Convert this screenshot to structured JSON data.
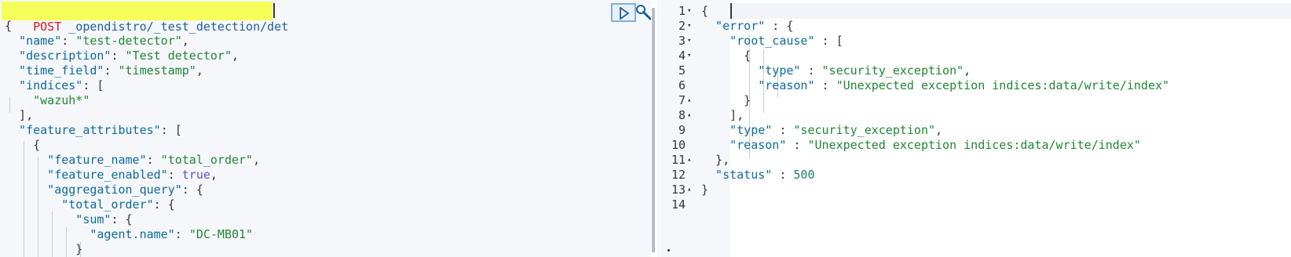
{
  "request": {
    "method": "POST",
    "url": " _opendistro/_test_detection/det",
    "lines": [
      [
        [
          "pun",
          "{"
        ]
      ],
      [
        [
          "key",
          "  \"name\""
        ],
        [
          "pun",
          ": "
        ],
        [
          "str",
          "\"test-detector\""
        ],
        [
          "pun",
          ","
        ]
      ],
      [
        [
          "key",
          "  \"description\""
        ],
        [
          "pun",
          ": "
        ],
        [
          "str",
          "\"Test detector\""
        ],
        [
          "pun",
          ","
        ]
      ],
      [
        [
          "key",
          "  \"time_field\""
        ],
        [
          "pun",
          ": "
        ],
        [
          "str",
          "\"timestamp\""
        ],
        [
          "pun",
          ","
        ]
      ],
      [
        [
          "key",
          "  \"indices\""
        ],
        [
          "pun",
          ": ["
        ]
      ],
      [
        [
          "str",
          "    \"wazuh*\""
        ]
      ],
      [
        [
          "pun",
          "  ],"
        ]
      ],
      [
        [
          "key",
          "  \"feature_attributes\""
        ],
        [
          "pun",
          ": ["
        ]
      ],
      [
        [
          "pun",
          "    {"
        ]
      ],
      [
        [
          "key",
          "      \"feature_name\""
        ],
        [
          "pun",
          ": "
        ],
        [
          "str",
          "\"total_order\""
        ],
        [
          "pun",
          ","
        ]
      ],
      [
        [
          "key",
          "      \"feature_enabled\""
        ],
        [
          "pun",
          ": "
        ],
        [
          "kw",
          "true"
        ],
        [
          "pun",
          ","
        ]
      ],
      [
        [
          "key",
          "      \"aggregation_query\""
        ],
        [
          "pun",
          ": {"
        ]
      ],
      [
        [
          "key",
          "        \"total_order\""
        ],
        [
          "pun",
          ": {"
        ]
      ],
      [
        [
          "key",
          "          \"sum\""
        ],
        [
          "pun",
          ": {"
        ]
      ],
      [
        [
          "key",
          "            \"agent.name\""
        ],
        [
          "pun",
          ": "
        ],
        [
          "str",
          "\"DC-MB01\""
        ]
      ],
      [
        [
          "pun",
          "          }"
        ]
      ]
    ]
  },
  "response": {
    "line_numbers": [
      "1",
      "2",
      "3",
      "4",
      "5",
      "6",
      "7",
      "8",
      "9",
      "10",
      "11",
      "12",
      "13",
      "14"
    ],
    "fold_markers": [
      "▾",
      "▾",
      "▾",
      "▾",
      "",
      "",
      "▴",
      "▴",
      "",
      "",
      "▴",
      "",
      "▴",
      ""
    ],
    "lines": [
      [
        [
          "pun",
          "{"
        ]
      ],
      [
        [
          "key",
          "  \"error\""
        ],
        [
          "pun",
          " : {"
        ]
      ],
      [
        [
          "key",
          "    \"root_cause\""
        ],
        [
          "pun",
          " : ["
        ]
      ],
      [
        [
          "pun",
          "      {"
        ]
      ],
      [
        [
          "key",
          "        \"type\""
        ],
        [
          "pun",
          " : "
        ],
        [
          "str",
          "\"security_exception\""
        ],
        [
          "pun",
          ","
        ]
      ],
      [
        [
          "key",
          "        \"reason\""
        ],
        [
          "pun",
          " : "
        ],
        [
          "str",
          "\"Unexpected exception indices:data/write/index\""
        ]
      ],
      [
        [
          "pun",
          "      }"
        ]
      ],
      [
        [
          "pun",
          "    ],"
        ]
      ],
      [
        [
          "key",
          "    \"type\""
        ],
        [
          "pun",
          " : "
        ],
        [
          "str",
          "\"security_exception\""
        ],
        [
          "pun",
          ","
        ]
      ],
      [
        [
          "key",
          "    \"reason\""
        ],
        [
          "pun",
          " : "
        ],
        [
          "str",
          "\"Unexpected exception indices:data/write/index\""
        ]
      ],
      [
        [
          "pun",
          "  },"
        ]
      ],
      [
        [
          "key",
          "  \"status\""
        ],
        [
          "pun",
          " : "
        ],
        [
          "num",
          "500"
        ]
      ],
      [
        [
          "pun",
          "}"
        ]
      ],
      []
    ]
  },
  "toolbar": {
    "run_icon": "play-icon",
    "settings_icon": "wrench-icon"
  }
}
